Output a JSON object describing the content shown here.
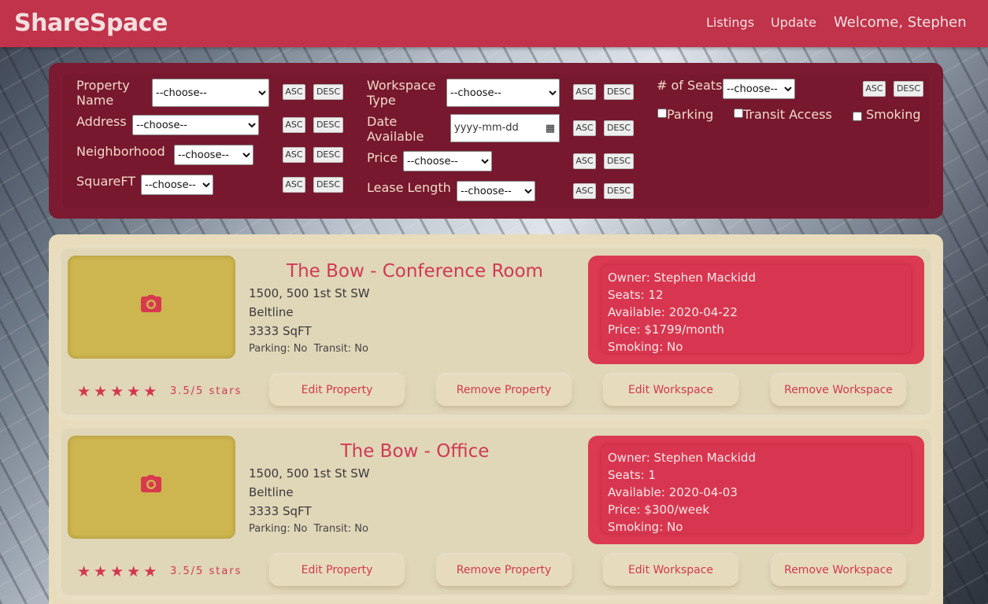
{
  "nav": {
    "brand": "ShareSpace",
    "links": [
      "Listings",
      "Update"
    ],
    "welcome": "Welcome, Stephen"
  },
  "filters": {
    "sort_asc": "ASC",
    "sort_desc": "DESC",
    "choose": "--choose--",
    "labels": {
      "property_name_1": "Property",
      "property_name_2": "Name",
      "address": "Address",
      "neighborhood": "Neighborhood",
      "squareft": "SquareFT",
      "workspace_type_1": "Workspace",
      "workspace_type_2": "Type",
      "date_available_1": "Date",
      "date_available_2": "Available",
      "price": "Price",
      "lease_length": "Lease Length",
      "seats": "# of Seats",
      "parking": "Parking",
      "transit": "Transit Access",
      "smoking": "Smoking"
    },
    "date_placeholder": "yyyy-mm-dd"
  },
  "listings": [
    {
      "title": "The Bow - Conference Room",
      "address": "1500, 500 1st St SW",
      "neighborhood": "Beltline",
      "size": "3333 SqFT",
      "amenities": "Parking: No  Transit: No",
      "owner": "Owner: Stephen Mackidd",
      "seats": "Seats: 12",
      "available": "Available: 2020-04-22",
      "price": "Price: $1799/month",
      "smoking": "Smoking: No",
      "rating": "3.5/5 stars"
    },
    {
      "title": "The Bow - Office",
      "address": "1500, 500 1st St SW",
      "neighborhood": "Beltline",
      "size": "3333 SqFT",
      "amenities": "Parking: No  Transit: No",
      "owner": "Owner: Stephen Mackidd",
      "seats": "Seats: 1",
      "available": "Available: 2020-04-03",
      "price": "Price: $300/week",
      "smoking": "Smoking: No",
      "rating": "3.5/5 stars"
    }
  ],
  "actions": {
    "edit_property": "Edit Property",
    "remove_property": "Remove Property",
    "edit_workspace": "Edit Workspace",
    "remove_workspace": "Remove Workspace"
  },
  "icons": {
    "camera": "camera-icon",
    "star": "star-icon",
    "calendar": "calendar-icon"
  },
  "colors": {
    "navbar": "#c0334b",
    "filter_panel": "#7b1a30",
    "listing_bg": "#e8dcbc",
    "accent": "#dc3a52",
    "thumb": "#cdb54f"
  }
}
